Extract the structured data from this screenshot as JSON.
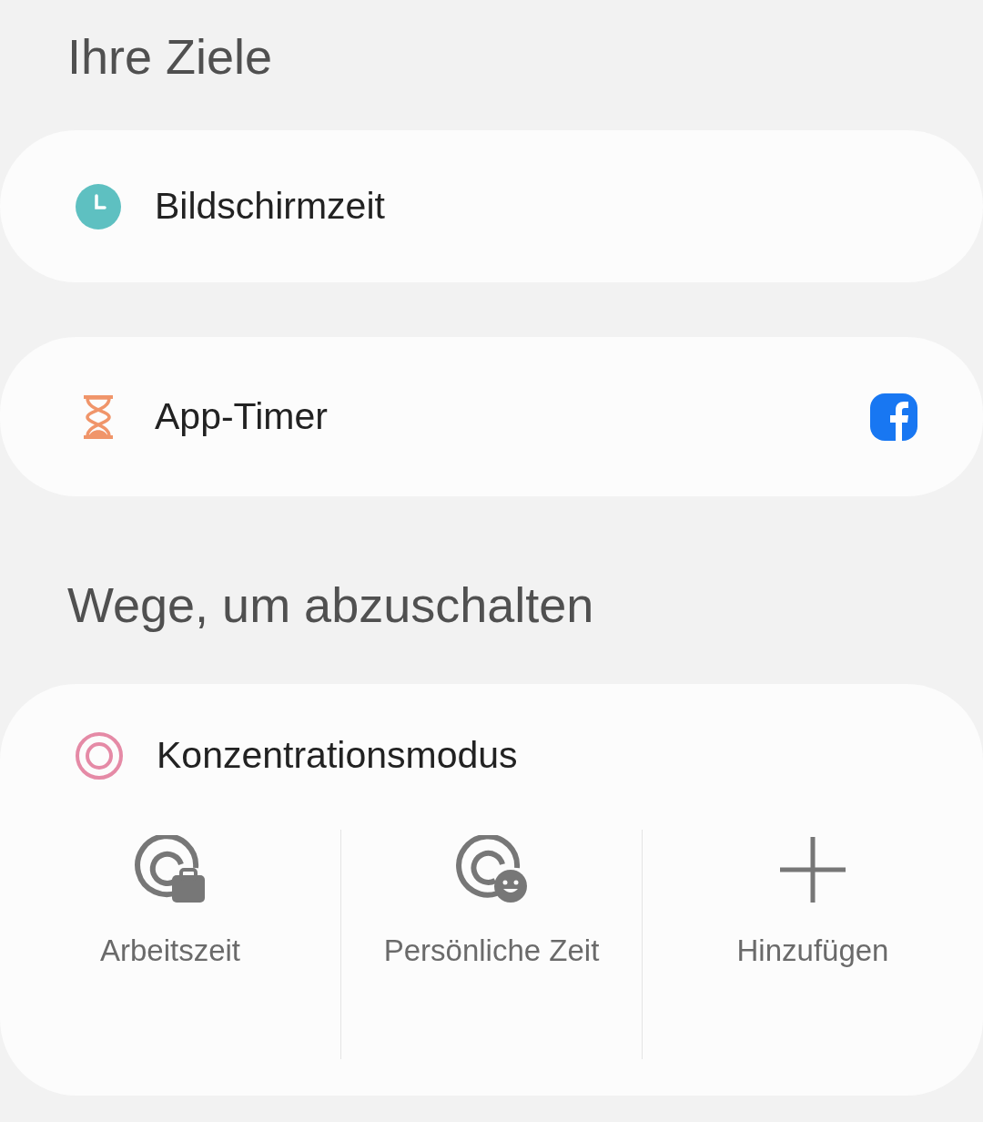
{
  "sections": [
    {
      "heading": "Ihre Ziele",
      "cards": [
        {
          "kind": "goal",
          "label": "Bildschirmzeit",
          "app_badge": false
        },
        {
          "kind": "goal",
          "label": "App-Timer",
          "app_badge": true
        }
      ]
    },
    {
      "heading": "Wege, um abzuschalten",
      "cards": [
        {
          "kind": "focus",
          "label": "Konzentrationsmodus",
          "modes": [
            {
              "label": "Arbeitszeit"
            },
            {
              "label": "Persönliche Zeit"
            },
            {
              "label": "Hinzufügen"
            }
          ]
        }
      ]
    }
  ]
}
